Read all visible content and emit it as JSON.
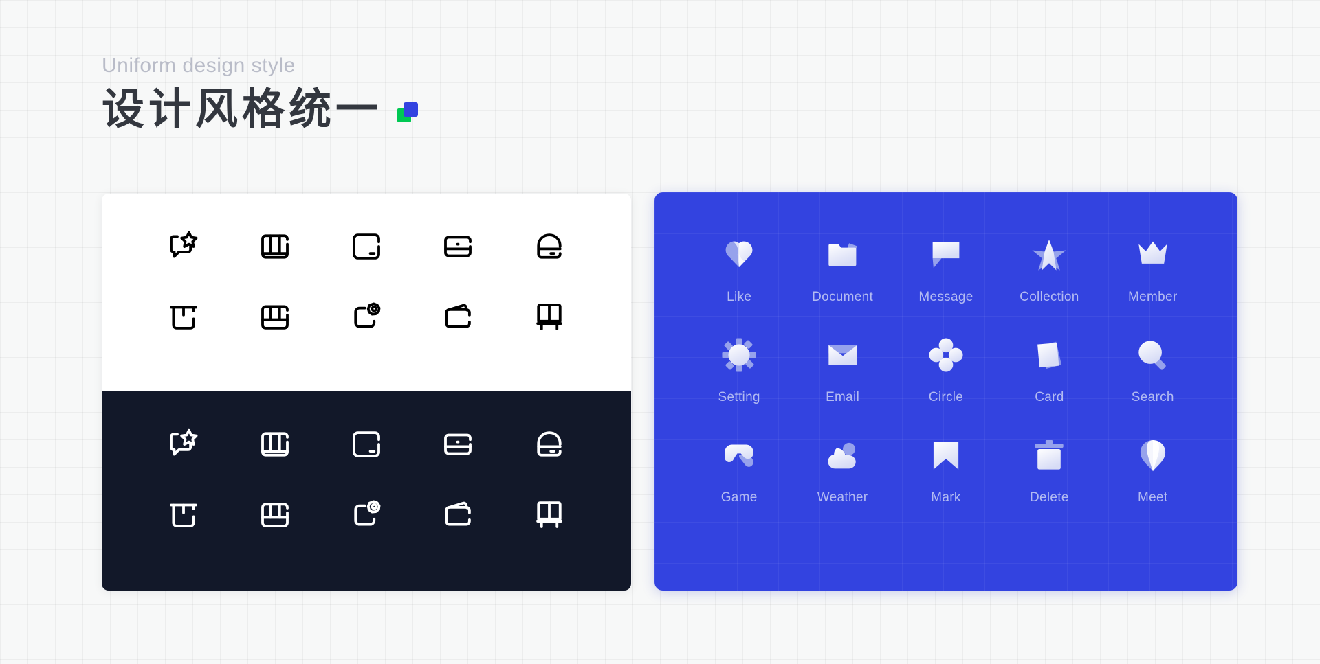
{
  "header": {
    "eyebrow": "Uniform design style",
    "title": "设计风格统一",
    "logo": {
      "green": "#00c853",
      "blue": "#3343e0"
    }
  },
  "theme": {
    "page_bg": "#f7f8f8",
    "light_panel_bg": "#ffffff",
    "dark_panel_bg": "#121829",
    "blue_panel_bg": "#3343e0",
    "outline_stroke_light": "#000000",
    "outline_stroke_dark": "#ffffff",
    "solid_label_color": "#b3bbf2"
  },
  "outline_panel": {
    "rows": [
      [
        {
          "icon": "message-star-icon"
        },
        {
          "icon": "container-box-icon"
        },
        {
          "icon": "rounded-square-dot-icon"
        },
        {
          "icon": "card-split-icon"
        },
        {
          "icon": "arch-dome-icon"
        }
      ],
      [
        {
          "icon": "box-open-icon"
        },
        {
          "icon": "basket-grid-icon"
        },
        {
          "icon": "gear-chat-icon"
        },
        {
          "icon": "wallet-flip-icon"
        },
        {
          "icon": "cabinet-legs-icon"
        }
      ]
    ]
  },
  "solid_panel": {
    "items": [
      {
        "icon": "heart-icon",
        "label": "Like"
      },
      {
        "icon": "folder-icon",
        "label": "Document"
      },
      {
        "icon": "speech-bubble-icon",
        "label": "Message"
      },
      {
        "icon": "star-icon",
        "label": "Collection"
      },
      {
        "icon": "crown-icon",
        "label": "Member"
      },
      {
        "icon": "gear-icon",
        "label": "Setting"
      },
      {
        "icon": "envelope-icon",
        "label": "Email"
      },
      {
        "icon": "clover-icon",
        "label": "Circle"
      },
      {
        "icon": "cards-icon",
        "label": "Card"
      },
      {
        "icon": "magnifier-icon",
        "label": "Search"
      },
      {
        "icon": "gamepad-icon",
        "label": "Game"
      },
      {
        "icon": "cloud-icon",
        "label": "Weather"
      },
      {
        "icon": "bookmark-icon",
        "label": "Mark"
      },
      {
        "icon": "trash-icon",
        "label": "Delete"
      },
      {
        "icon": "map-pin-icon",
        "label": "Meet"
      }
    ]
  }
}
